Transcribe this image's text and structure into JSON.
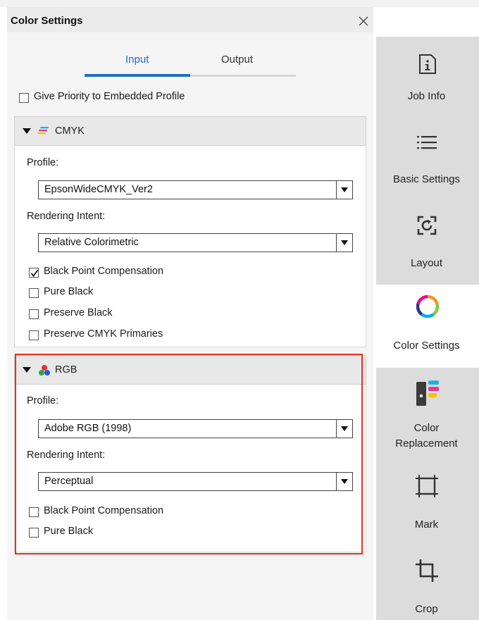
{
  "panel": {
    "title": "Color Settings"
  },
  "tabs": [
    {
      "label": "Input"
    },
    {
      "label": "Output"
    }
  ],
  "priority": {
    "label": "Give Priority to Embedded Profile",
    "checked": false
  },
  "cmyk": {
    "title": "CMYK",
    "profile_label": "Profile:",
    "profile_value": "EpsonWideCMYK_Ver2",
    "intent_label": "Rendering Intent:",
    "intent_value": "Relative Colorimetric",
    "options": [
      {
        "label": "Black Point Compensation",
        "checked": true
      },
      {
        "label": "Pure Black",
        "checked": false
      },
      {
        "label": "Preserve Black",
        "checked": false
      },
      {
        "label": "Preserve CMYK Primaries",
        "checked": false
      }
    ]
  },
  "rgb": {
    "title": "RGB",
    "profile_label": "Profile:",
    "profile_value": "Adobe RGB (1998)",
    "intent_label": "Rendering Intent:",
    "intent_value": "Perceptual",
    "options": [
      {
        "label": "Black Point Compensation",
        "checked": false
      },
      {
        "label": "Pure Black",
        "checked": false
      }
    ]
  },
  "sidebar": {
    "items": [
      {
        "label": "Job Info",
        "icon": "info-icon"
      },
      {
        "label": "Basic Settings",
        "icon": "list-icon"
      },
      {
        "label": "Layout",
        "icon": "layout-icon"
      },
      {
        "label": "Color Settings",
        "icon": "color-wheel-icon",
        "active": true
      },
      {
        "label_line1": "Color",
        "label_line2": "Replacement",
        "icon": "color-replacement-icon"
      },
      {
        "label": "Mark",
        "icon": "mark-icon"
      },
      {
        "label": "Crop",
        "icon": "crop-icon"
      }
    ]
  },
  "colors": {
    "accent": "#1f6fc5",
    "highlight": "#e8311f",
    "sidebar_bg": "#dcdcdc"
  }
}
